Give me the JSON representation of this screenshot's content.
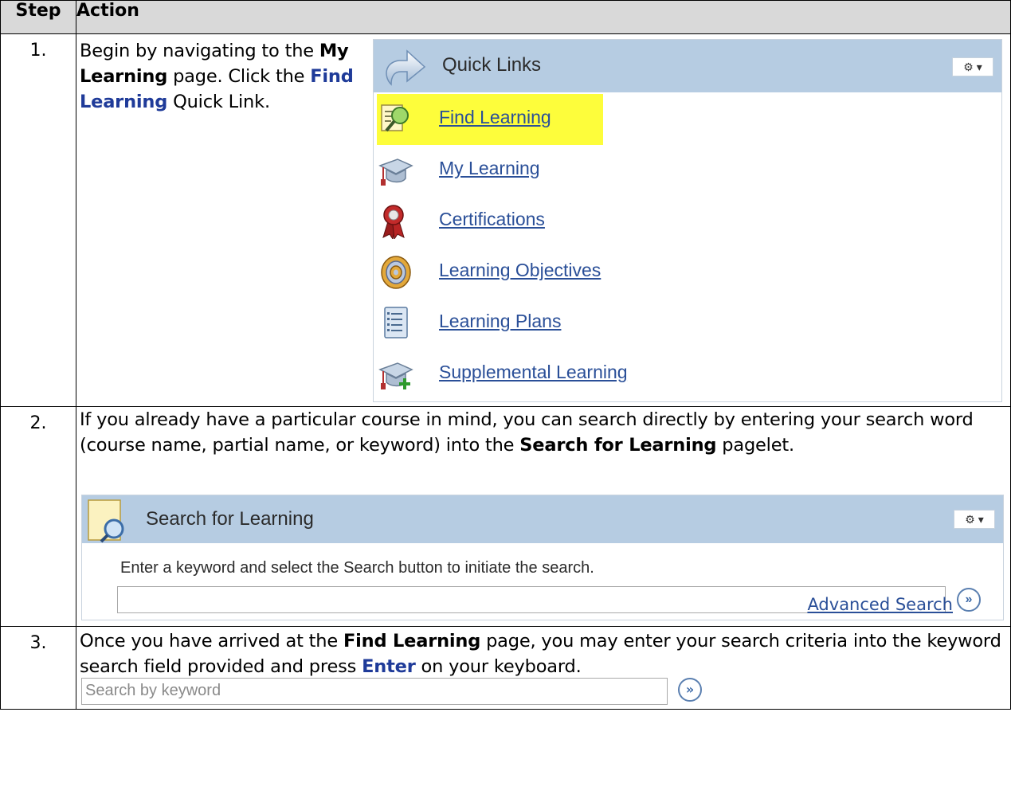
{
  "table": {
    "col_step": "Step",
    "col_action": "Action"
  },
  "steps": [
    {
      "number": "1.",
      "text_parts": [
        "Begin by navigating to the ",
        "My Learning",
        " page.  Click the ",
        "Find Learning",
        " Quick Link."
      ]
    },
    {
      "number": "2.",
      "text_parts": [
        "If you already have a particular course in mind, you can search directly by entering your search word (course name, partial name, or keyword) into the ",
        "Search for Learning",
        " pagelet."
      ]
    },
    {
      "number": "3.",
      "text_parts": [
        "Once you have arrived at the ",
        "Find Learning",
        " page, you may enter your search criteria into the keyword search field provided and press ",
        "Enter",
        " on your keyboard."
      ]
    }
  ],
  "quick_links": {
    "title": "Quick Links",
    "gear": "⚙ ▾",
    "items": [
      {
        "label": "Find Learning",
        "icon": "find-learning-icon",
        "highlighted": true
      },
      {
        "label": "My Learning",
        "icon": "graduation-cap-icon"
      },
      {
        "label": "Certifications",
        "icon": "ribbon-award-icon"
      },
      {
        "label": "Learning Objectives",
        "icon": "target-icon"
      },
      {
        "label": "Learning Plans",
        "icon": "checklist-icon"
      },
      {
        "label": "Supplemental Learning",
        "icon": "graduation-cap-plus-icon"
      }
    ]
  },
  "search_pagelet": {
    "title": "Search for Learning",
    "gear": "⚙ ▾",
    "instruction": "Enter a keyword and select the Search button to initiate the search.",
    "input_value": "",
    "go": "»",
    "advanced_link": "Advanced Search"
  },
  "keyword_search": {
    "placeholder": "Search by keyword",
    "go": "»"
  },
  "colors": {
    "header_bg": "#d9d9d9",
    "pagelet_header": "#b6cce2",
    "link": "#2a4f98",
    "keyword_blue": "#1f3b99",
    "highlight": "#fdfd3b"
  }
}
